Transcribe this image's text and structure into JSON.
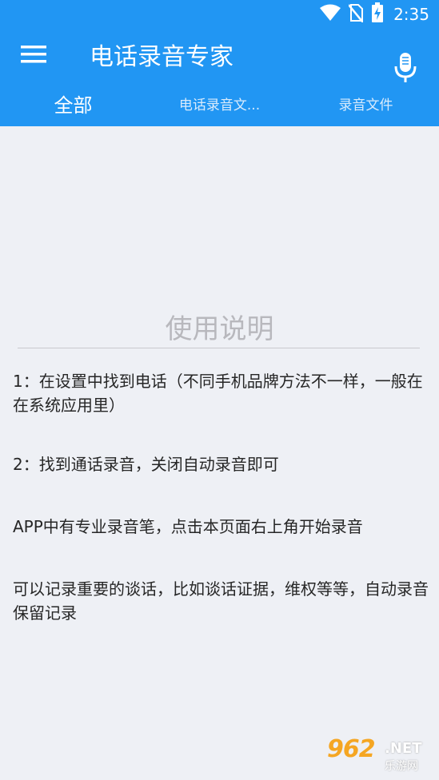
{
  "status_bar": {
    "time": "2:35",
    "icons": [
      "wifi-icon",
      "no-sim-icon",
      "battery-charging-icon"
    ]
  },
  "app_bar": {
    "title": "电话录音专家",
    "menu_icon": "hamburger-menu-icon",
    "mic_icon": "microphone-icon",
    "background_color": "#2196f3"
  },
  "tabs": [
    {
      "label": "全部",
      "selected": true
    },
    {
      "label": "电话录音文...",
      "selected": false
    },
    {
      "label": "录音文件",
      "selected": false
    }
  ],
  "instructions": {
    "title": "使用说明",
    "paragraphs": [
      "1：在设置中找到电话（不同手机品牌方法不一样，一般在在系统应用里）",
      "2：找到通话录音，关闭自动录音即可",
      "APP中有专业录音笔，点击本页面右上角开始录音",
      "可以记录重要的谈话，比如谈话证据，维权等等，自动录音保留记录"
    ]
  },
  "watermark": {
    "brand": "962",
    "suffix": ".NET",
    "subtitle": "乐游网"
  }
}
